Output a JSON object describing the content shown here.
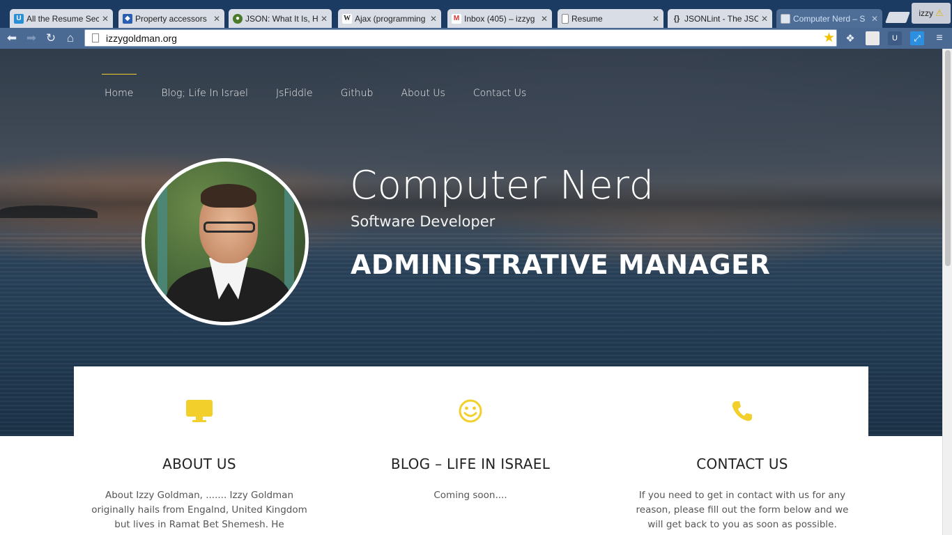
{
  "browser": {
    "tabs": [
      {
        "title": "All the Resume Sec",
        "favicon": "upwork-icon",
        "color": "#2a8fd6"
      },
      {
        "title": "Property accessors",
        "favicon": "mdn-icon",
        "color": "#2a5fb0"
      },
      {
        "title": "JSON: What It Is, Ho",
        "favicon": "eye-icon",
        "color": "#4b7a2a"
      },
      {
        "title": "Ajax (programming",
        "favicon": "wikipedia-icon",
        "color": "#333333"
      },
      {
        "title": "Inbox (405) – izzyg",
        "favicon": "gmail-icon",
        "color": "#d33"
      },
      {
        "title": "Resume",
        "favicon": "document-icon",
        "color": "#777777"
      },
      {
        "title": "JSONLint - The JSON",
        "favicon": "braces-icon",
        "color": "#444444"
      },
      {
        "title": "Computer Nerd – S",
        "favicon": "page-icon",
        "color": "#dddddd"
      }
    ],
    "profile_name": "izzy",
    "url": "izzygoldman.org"
  },
  "nav": {
    "items": [
      "Home",
      "Blog; Life In Israel",
      "JsFiddle",
      "Github",
      "About Us",
      "Contact Us"
    ]
  },
  "hero": {
    "title": "Computer Nerd",
    "subtitle": "Software Developer",
    "role": "ADMINISTRATIVE MANAGER"
  },
  "features": [
    {
      "icon": "monitor-icon",
      "title": "ABOUT US",
      "text": "About Izzy Goldman, ....... Izzy Goldman originally hails from Engalnd, United Kingdom but lives in Ramat Bet Shemesh. He specializes in being a good Yeshiva Rebbi, working as a Rebbi"
    },
    {
      "icon": "smiley-icon",
      "title": "BLOG – LIFE IN ISRAEL",
      "text": "Coming soon...."
    },
    {
      "icon": "phone-icon",
      "title": "CONTACT US",
      "text": "If you need to get in contact with us for any reason, please fill out the form below and we will get back to you as soon as possible."
    }
  ],
  "colors": {
    "accent": "#f3cf2b",
    "tabstrip": "#1c3b63",
    "toolbar": "#4a6a94"
  }
}
